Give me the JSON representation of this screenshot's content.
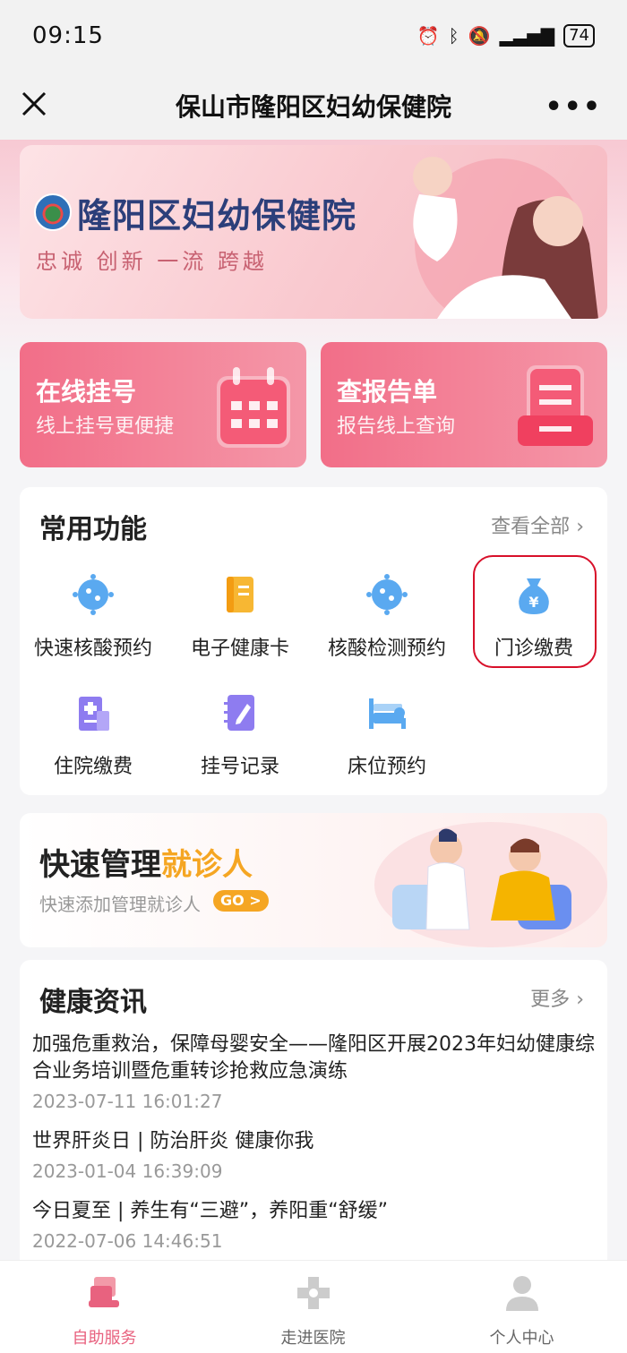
{
  "status_bar": {
    "time": "09:15",
    "battery": "74"
  },
  "nav": {
    "title": "保山市隆阳区妇幼保健院"
  },
  "banner": {
    "hospital_name": "隆阳区妇幼保健院",
    "slogan": "忠诚 创新 一流 跨越"
  },
  "quick_cards": [
    {
      "title": "在线挂号",
      "subtitle": "线上挂号更便捷"
    },
    {
      "title": "查报告单",
      "subtitle": "报告线上查询"
    }
  ],
  "functions": {
    "title": "常用功能",
    "more_label": "查看全部",
    "items": [
      {
        "label": "快速核酸预约",
        "icon": "virus-icon"
      },
      {
        "label": "电子健康卡",
        "icon": "health-card-icon"
      },
      {
        "label": "核酸检测预约",
        "icon": "virus-icon"
      },
      {
        "label": "门诊缴费",
        "icon": "money-bag-icon"
      },
      {
        "label": "住院缴费",
        "icon": "hospital-bill-icon"
      },
      {
        "label": "挂号记录",
        "icon": "notebook-icon"
      },
      {
        "label": "床位预约",
        "icon": "bed-icon"
      }
    ]
  },
  "manage": {
    "title_main": "快速管理",
    "title_accent": "就诊人",
    "subtitle": "快速添加管理就诊人",
    "go_label": "GO >"
  },
  "news": {
    "title": "健康资讯",
    "more_label": "更多",
    "items": [
      {
        "title": "加强危重救治，保障母婴安全——隆阳区开展2023年妇幼健康综合业务培训暨危重转诊抢救应急演练",
        "date": "2023-07-11 16:01:27"
      },
      {
        "title": "世界肝炎日 | 防治肝炎 健康你我",
        "date": "2023-01-04 16:39:09"
      },
      {
        "title": "今日夏至 | 养生有“三避”，养阳重“舒缓”",
        "date": "2022-07-06 14:46:51"
      }
    ]
  },
  "tabs": [
    {
      "label": "自助服务",
      "icon": "self-service-icon"
    },
    {
      "label": "走进医院",
      "icon": "hospital-cross-icon"
    },
    {
      "label": "个人中心",
      "icon": "user-icon"
    }
  ],
  "colors": {
    "accent": "#e8627f",
    "brand_pink": "#f26e88",
    "highlight": "#d8102a",
    "orange": "#f5a623"
  }
}
